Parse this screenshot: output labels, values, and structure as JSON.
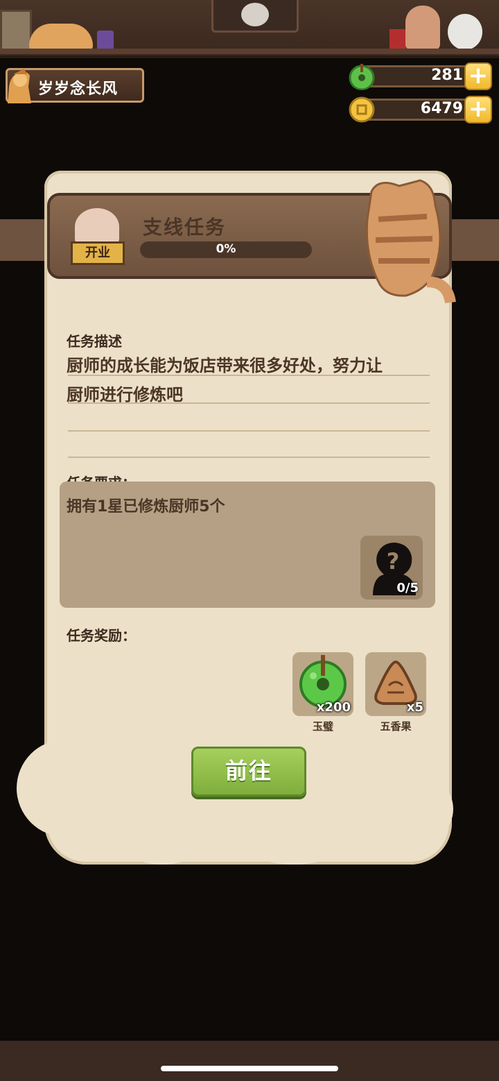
{
  "player": {
    "name": "岁岁念长风"
  },
  "currency": {
    "jade": {
      "value": "281",
      "icon": "jade-disc-icon"
    },
    "coins": {
      "value": "6479",
      "icon": "coin-icon"
    },
    "plus_label": "+"
  },
  "quest": {
    "badge": "开业",
    "title": "支线任务",
    "progress_text": "0%",
    "progress": 0,
    "desc_label": "任务描述",
    "description_line1": "厨师的成长能为饭店带来很多好处，努力让",
    "description_line2": "厨师进行修炼吧",
    "req_label": "任务要求：",
    "requirement": "拥有1星已修炼厨师5个",
    "req_count": "0/5",
    "reward_label": "任务奖励：",
    "rewards": [
      {
        "name": "玉璧",
        "count": "x200",
        "icon": "jade-disc-icon"
      },
      {
        "name": "五香果",
        "count": "x5",
        "icon": "spiced-fruit-icon"
      }
    ],
    "go_button": "前往"
  },
  "colors": {
    "panel": "#ece0c9",
    "banner": "#7a5c46",
    "button_green": "#8fbe4a",
    "gold": "#f0b82c"
  }
}
